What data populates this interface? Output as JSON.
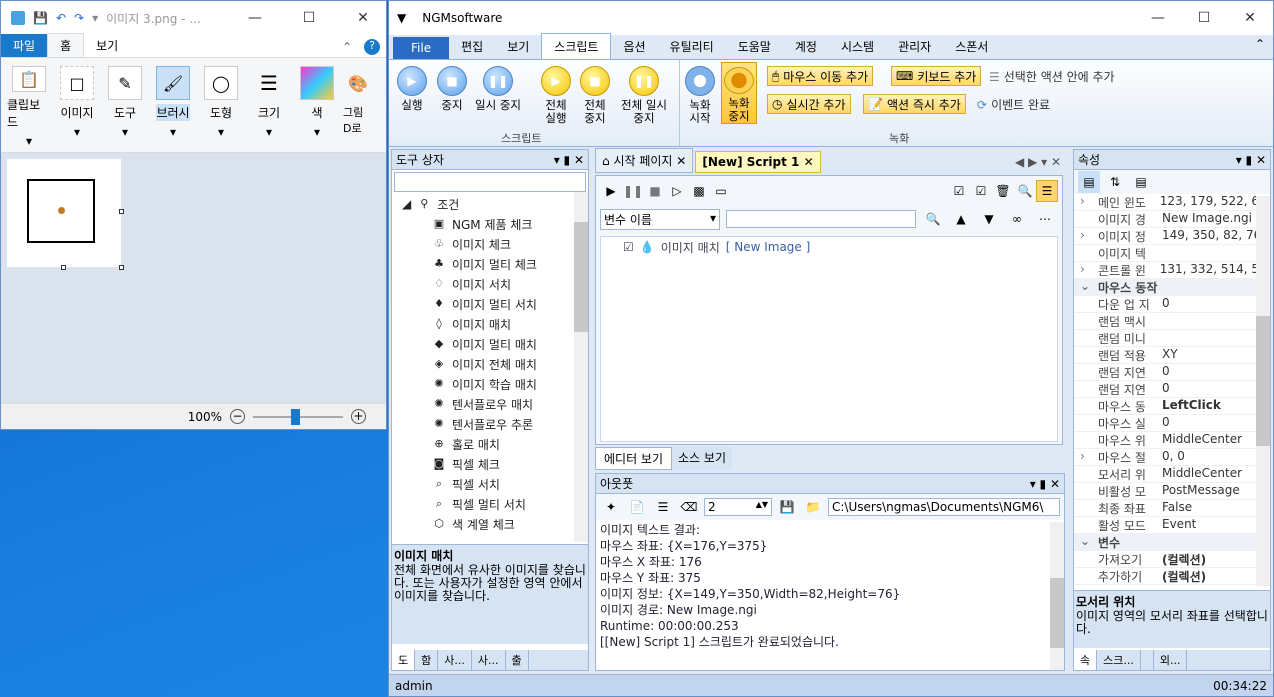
{
  "paint": {
    "title": "이미지 3.png - ...",
    "tabs": [
      "파일",
      "홈",
      "보기"
    ],
    "ribbon": [
      {
        "label": "클립보드",
        "icon": "clipboard-icon"
      },
      {
        "label": "이미지",
        "icon": "select-icon"
      },
      {
        "label": "도구",
        "icon": "tools-icon"
      },
      {
        "label": "브러시",
        "icon": "brush-icon"
      },
      {
        "label": "도형",
        "icon": "shapes-icon"
      },
      {
        "label": "크기",
        "icon": "size-icon"
      },
      {
        "label": "색",
        "icon": "color-icon"
      },
      {
        "label": "그림 D로",
        "icon": "paint3d-icon"
      }
    ],
    "zoom": "100%"
  },
  "ngm": {
    "title": "NGMsoftware",
    "menu": [
      "File",
      "편집",
      "보기",
      "스크립트",
      "옵션",
      "유틸리티",
      "도움말",
      "계정",
      "시스템",
      "관리자",
      "스폰서"
    ],
    "ribbon": {
      "run": "실행",
      "stop": "중지",
      "pause": "일시 중지",
      "run_all": "전체 실행",
      "stop_all": "전체 중지",
      "pause_all": "전체 일시 중지",
      "group_script": "스크립트",
      "rec_start": "녹화 시작",
      "rec_stop": "녹화 중지",
      "add_mouse": "마우스 이동 추가",
      "add_kbd": "키보드 추가",
      "add_into": "선택한 액션 안에 추가",
      "add_realtime": "실시간 추가",
      "add_action_now": "액션 즉시 추가",
      "event_done": "이벤트 완료",
      "group_record": "녹화"
    },
    "toolbox": {
      "title": "도구 상자",
      "root": "조건",
      "items": [
        {
          "label": "NGM 제품 체크",
          "icon": "ngm-icon"
        },
        {
          "label": "이미지 체크",
          "icon": "tree-outline-icon"
        },
        {
          "label": "이미지 멀티 체크",
          "icon": "tree-filled-icon"
        },
        {
          "label": "이미지 서치",
          "icon": "drops-outline-icon"
        },
        {
          "label": "이미지 멀티 서치",
          "icon": "drops-filled-icon"
        },
        {
          "label": "이미지 매치",
          "icon": "drops-match-icon"
        },
        {
          "label": "이미지 멀티 매치",
          "icon": "drops-multi-icon"
        },
        {
          "label": "이미지 전체 매치",
          "icon": "drops-all-icon"
        },
        {
          "label": "이미지 학습 매치",
          "icon": "neural-icon"
        },
        {
          "label": "텐서플로우 매치",
          "icon": "neural-icon"
        },
        {
          "label": "텐서플로우 추론",
          "icon": "neural-icon"
        },
        {
          "label": "홀로 매치",
          "icon": "crosshair-icon"
        },
        {
          "label": "픽셀 체크",
          "icon": "camera-icon"
        },
        {
          "label": "픽셀 서치",
          "icon": "magnifier-icon"
        },
        {
          "label": "픽셀 멀티 서치",
          "icon": "magnifier-icon"
        },
        {
          "label": "색 계열 체크",
          "icon": "cube-icon"
        }
      ],
      "desc_title": "이미지 매치",
      "desc_body": "전체 화면에서 유사한 이미지를 찾습니다. 또는 사용자가 설정한 영역 안에서 이미지를 찾습니다.",
      "bottom_tabs": [
        "도",
        "함",
        "사...",
        "사...",
        "출"
      ]
    },
    "editor": {
      "tabs": [
        "시작 페이지",
        "[New] Script 1"
      ],
      "var_select": "변수 이름",
      "node_label": "이미지 매치",
      "node_value": "[ New Image ]",
      "view_tabs": [
        "에디터 보기",
        "소스 보기"
      ]
    },
    "output": {
      "title": "아웃풋",
      "spin_value": "2",
      "path": "C:\\Users\\ngmas\\Documents\\NGM6\\",
      "lines": [
        "이미지 텍스트 결과:",
        "마우스 좌표: {X=176,Y=375}",
        "마우스 X 좌표: 176",
        "마우스 Y 좌표: 375",
        "이미지 정보: {X=149,Y=350,Width=82,Height=76}",
        "이미지 경로: New Image.ngi",
        "Runtime: 00:00:00.253",
        "[[New] Script 1] 스크립트가 완료되었습니다."
      ]
    },
    "props": {
      "title": "속성",
      "rows": [
        {
          "k": "메인 윈도",
          "v": "123, 179, 522, 615",
          "exp": true
        },
        {
          "k": "이미지 경",
          "v": "New Image.ngi"
        },
        {
          "k": "이미지 정",
          "v": "149, 350, 82, 76",
          "exp": true
        },
        {
          "k": "이미지 텍",
          "v": ""
        },
        {
          "k": "콘트롤 윈",
          "v": "131, 332, 514, 581",
          "exp": true
        },
        {
          "k": "마우스 동작",
          "v": "",
          "cat": true
        },
        {
          "k": "다운 업 지",
          "v": "0"
        },
        {
          "k": "랜덤 맥시",
          "v": ""
        },
        {
          "k": "랜덤 미니",
          "v": ""
        },
        {
          "k": "랜덤 적용",
          "v": "XY"
        },
        {
          "k": "랜덤 지연",
          "v": "0"
        },
        {
          "k": "랜덤 지연",
          "v": "0"
        },
        {
          "k": "마우스 동",
          "v": "LeftClick",
          "bold": true
        },
        {
          "k": "마우스 실",
          "v": "0"
        },
        {
          "k": "마우스 위",
          "v": "MiddleCenter"
        },
        {
          "k": "마우스 절",
          "v": "0, 0",
          "exp": true
        },
        {
          "k": "모서리 위",
          "v": "MiddleCenter"
        },
        {
          "k": "비활성 모",
          "v": "PostMessage"
        },
        {
          "k": "최종 좌표",
          "v": "False"
        },
        {
          "k": "활성 모드",
          "v": "Event"
        },
        {
          "k": "변수",
          "v": "",
          "cat": true
        },
        {
          "k": "가져오기",
          "v": "(컬렉션)",
          "bold": true
        },
        {
          "k": "추가하기",
          "v": "(컬렉션)",
          "bold": true
        }
      ],
      "desc_title": "모서리 위치",
      "desc_body": "이미지 영역의 모서리 좌표를 선택합니다.",
      "bottom_tabs": [
        "속",
        "스크...",
        "",
        "외..."
      ]
    },
    "status": {
      "user": "admin",
      "time": "00:34:22"
    }
  }
}
